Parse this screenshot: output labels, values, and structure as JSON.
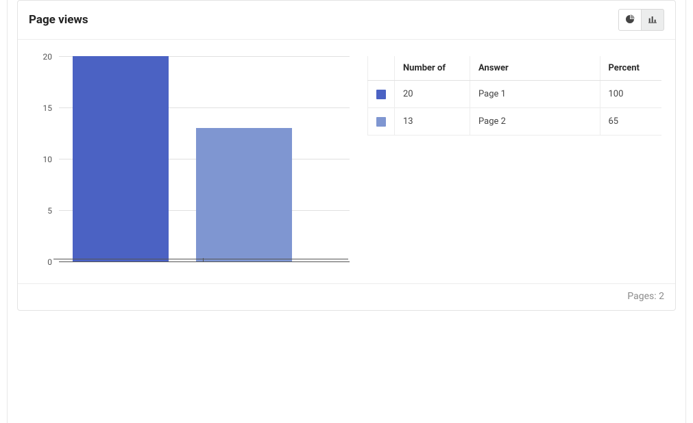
{
  "card": {
    "title": "Page views",
    "footer_label": "Pages:",
    "footer_count": "2"
  },
  "table": {
    "headers": {
      "count": "Number of",
      "answer": "Answer",
      "percent": "Percent"
    },
    "rows": [
      {
        "color": "#4b62c3",
        "count": "20",
        "answer": "Page 1",
        "percent": "100"
      },
      {
        "color": "#7f96d1",
        "count": "13",
        "answer": "Page 2",
        "percent": "65"
      }
    ]
  },
  "chart_data": {
    "type": "bar",
    "title": "Page views",
    "xlabel": "",
    "ylabel": "",
    "ylim": [
      0,
      20
    ],
    "yticks": [
      0,
      5,
      10,
      15,
      20
    ],
    "categories": [
      "Page 1",
      "Page 2"
    ],
    "values": [
      20,
      13
    ],
    "colors": [
      "#4b62c3",
      "#7f96d1"
    ]
  }
}
